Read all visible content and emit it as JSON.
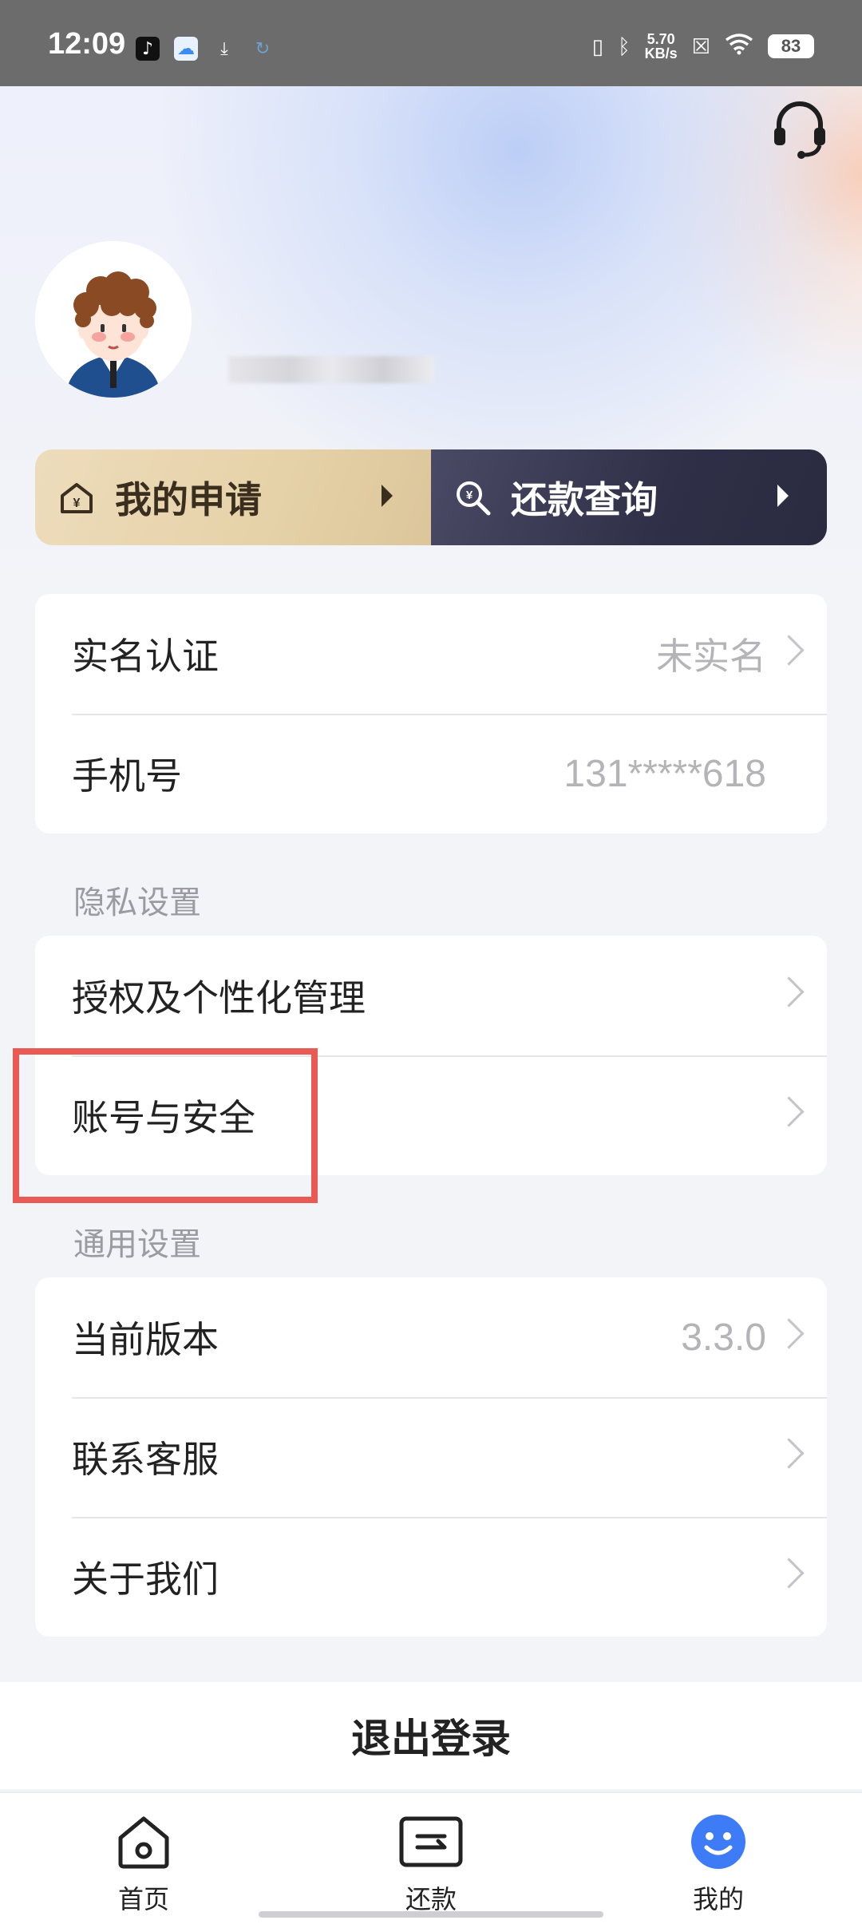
{
  "status_bar": {
    "time": "12:09",
    "net_speed_value": "5.70",
    "net_speed_unit": "KB/s",
    "battery": "83"
  },
  "header": {
    "support_icon": "headset-icon"
  },
  "profile": {
    "avatar_icon": "cartoon-avatar"
  },
  "quick_actions": {
    "apply_label": "我的申请",
    "repay_query_label": "还款查询"
  },
  "account_card": {
    "real_name_label": "实名认证",
    "real_name_value": "未实名",
    "phone_label": "手机号",
    "phone_value": "131*****618"
  },
  "privacy_section": {
    "title": "隐私设置",
    "items": [
      {
        "label": "授权及个性化管理"
      },
      {
        "label": "账号与安全"
      }
    ]
  },
  "general_section": {
    "title": "通用设置",
    "version_label": "当前版本",
    "version_value": "3.3.0",
    "support_label": "联系客服",
    "about_label": "关于我们"
  },
  "logout": {
    "label": "退出登录"
  },
  "bottom_nav": {
    "items": [
      {
        "label": "首页",
        "icon": "home-icon"
      },
      {
        "label": "还款",
        "icon": "repay-icon"
      },
      {
        "label": "我的",
        "icon": "smile-icon"
      }
    ]
  },
  "colors": {
    "accent_blue": "#3e7bf7",
    "highlight_red": "#ea5a55"
  }
}
